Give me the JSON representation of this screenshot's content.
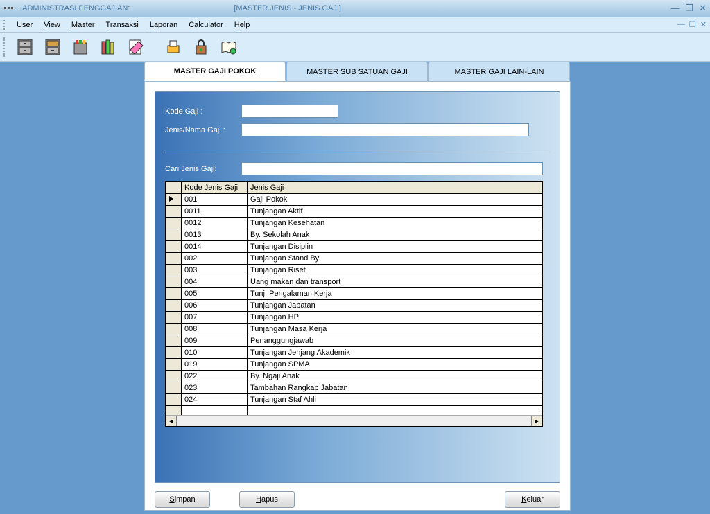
{
  "titlebar": {
    "app_title": "::ADMINISTRASI PENGGAJIAN:",
    "doc_title": "[MASTER JENIS - JENIS GAJI]"
  },
  "menubar": {
    "items": [
      {
        "label": "User",
        "ul": "U"
      },
      {
        "label": "View",
        "ul": "V"
      },
      {
        "label": "Master",
        "ul": "M"
      },
      {
        "label": "Transaksi",
        "ul": "T"
      },
      {
        "label": "Laporan",
        "ul": "L"
      },
      {
        "label": "Calculator",
        "ul": "C"
      },
      {
        "label": "Help",
        "ul": "H"
      }
    ]
  },
  "tabs": {
    "t0": "MASTER GAJI POKOK",
    "t1": "MASTER SUB SATUAN GAJI",
    "t2": "MASTER GAJI LAIN-LAIN"
  },
  "fields": {
    "kode_label": "Kode Gaji :",
    "kode_value": "",
    "nama_label": "Jenis/Nama Gaji :",
    "nama_value": "",
    "search_label": "Cari Jenis Gaji:",
    "search_value": ""
  },
  "grid": {
    "headers": {
      "code": "Kode Jenis Gaji",
      "name": "Jenis Gaji"
    },
    "rows": [
      {
        "code": "001",
        "name": "Gaji Pokok"
      },
      {
        "code": "0011",
        "name": "Tunjangan Aktif"
      },
      {
        "code": "0012",
        "name": "Tunjangan Kesehatan"
      },
      {
        "code": "0013",
        "name": "By. Sekolah Anak"
      },
      {
        "code": "0014",
        "name": "Tunjangan Disiplin"
      },
      {
        "code": "002",
        "name": "Tunjangan Stand By"
      },
      {
        "code": "003",
        "name": "Tunjangan Riset"
      },
      {
        "code": "004",
        "name": "Uang makan dan transport"
      },
      {
        "code": "005",
        "name": "Tunj. Pengalaman Kerja"
      },
      {
        "code": "006",
        "name": "Tunjangan Jabatan"
      },
      {
        "code": "007",
        "name": "Tunjangan HP"
      },
      {
        "code": "008",
        "name": "Tunjangan Masa Kerja"
      },
      {
        "code": "009",
        "name": "Penanggungjawab"
      },
      {
        "code": "010",
        "name": "Tunjangan Jenjang Akademik"
      },
      {
        "code": "019",
        "name": "Tunjangan SPMA"
      },
      {
        "code": "022",
        "name": "By. Ngaji Anak"
      },
      {
        "code": "023",
        "name": "Tambahan Rangkap Jabatan"
      },
      {
        "code": "024",
        "name": "Tunjangan Staf Ahli"
      }
    ]
  },
  "buttons": {
    "save": "Simpan",
    "delete": "Hapus",
    "exit": "Keluar"
  }
}
